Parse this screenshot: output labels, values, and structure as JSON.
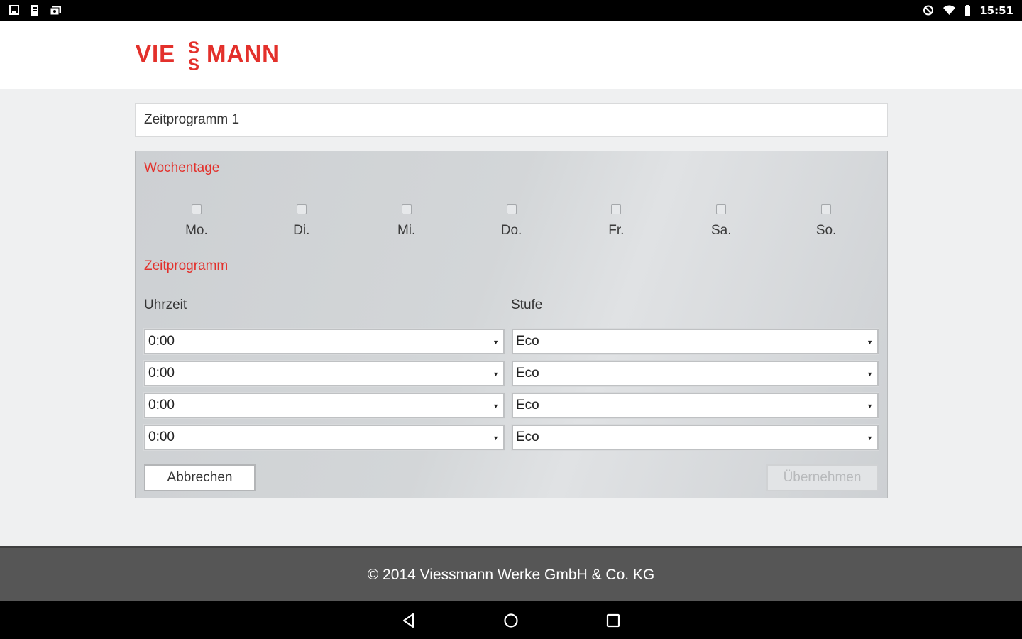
{
  "status_bar": {
    "time": "15:51"
  },
  "header": {
    "logo_text": "VIESSMANN",
    "brand_color": "#e3302b"
  },
  "program": {
    "name_value": "Zeitprogramm 1"
  },
  "weekdays": {
    "title": "Wochentage",
    "days": [
      {
        "label": "Mo.",
        "checked": false
      },
      {
        "label": "Di.",
        "checked": false
      },
      {
        "label": "Mi.",
        "checked": false
      },
      {
        "label": "Do.",
        "checked": false
      },
      {
        "label": "Fr.",
        "checked": false
      },
      {
        "label": "Sa.",
        "checked": false
      },
      {
        "label": "So.",
        "checked": false
      }
    ]
  },
  "schedule": {
    "title": "Zeitprogramm",
    "time_header": "Uhrzeit",
    "level_header": "Stufe",
    "rows": [
      {
        "time": "0:00",
        "level": "Eco"
      },
      {
        "time": "0:00",
        "level": "Eco"
      },
      {
        "time": "0:00",
        "level": "Eco"
      },
      {
        "time": "0:00",
        "level": "Eco"
      }
    ]
  },
  "actions": {
    "cancel_label": "Abbrechen",
    "apply_label": "Übernehmen"
  },
  "footer": {
    "copyright": "© 2014 Viessmann Werke GmbH & Co. KG"
  }
}
